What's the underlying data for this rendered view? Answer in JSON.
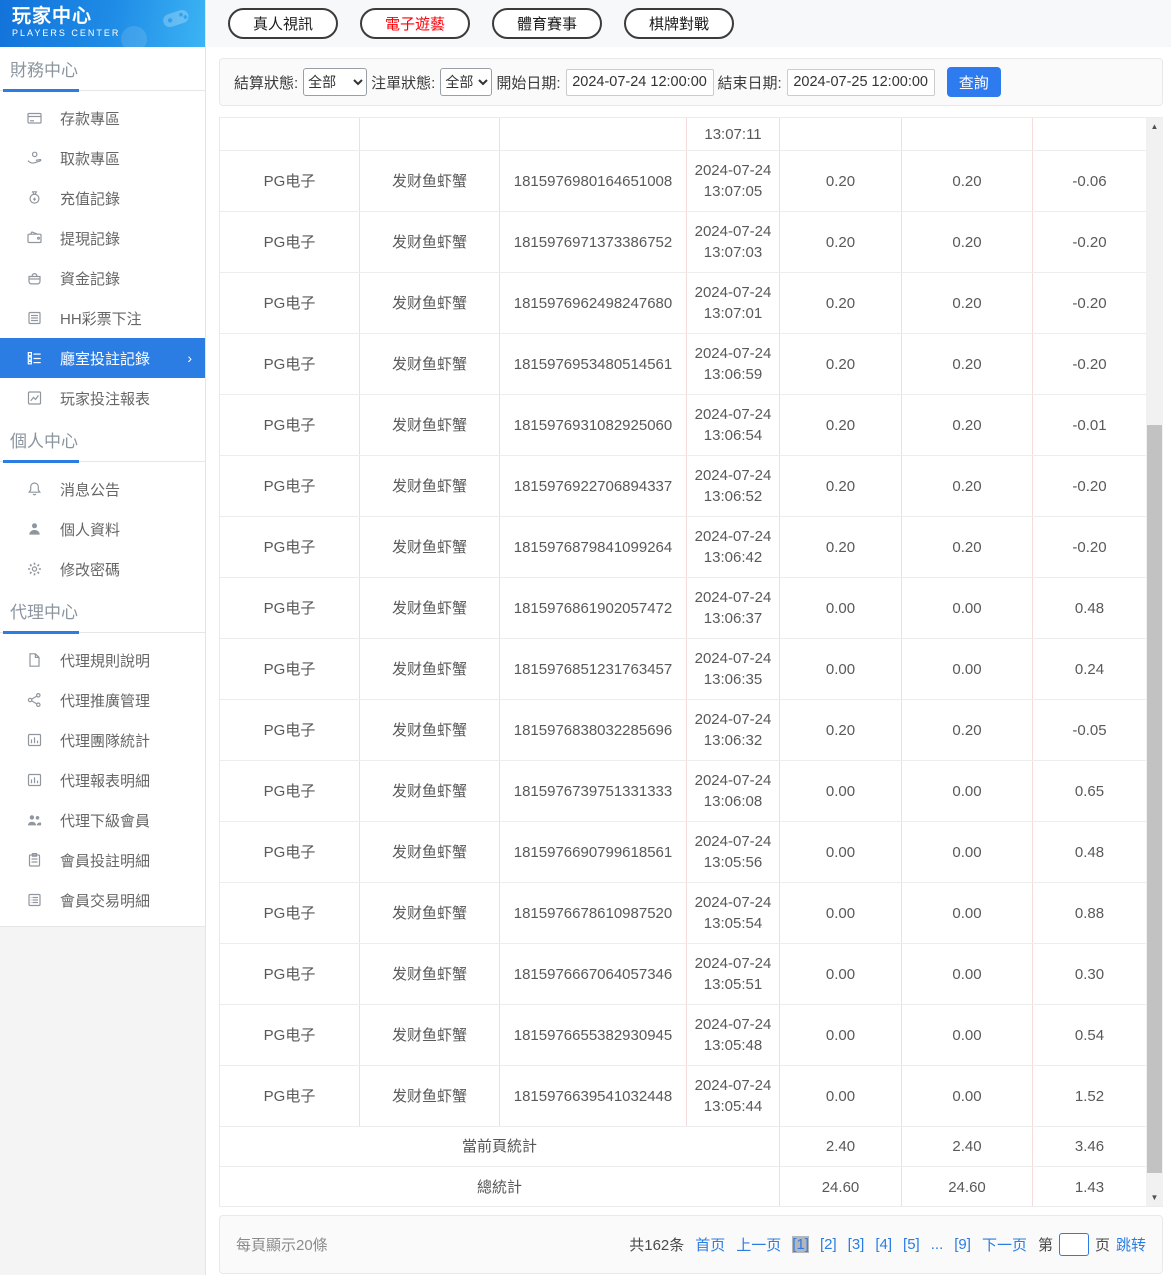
{
  "sidebar": {
    "title": "玩家中心",
    "subtitle": "PLAYERS CENTER",
    "sections": [
      {
        "header": "財務中心",
        "items": [
          {
            "id": "deposit-zone",
            "label": "存款專區",
            "icon": "card",
            "active": false
          },
          {
            "id": "withdraw-zone",
            "label": "取款專區",
            "icon": "hand",
            "active": false
          },
          {
            "id": "recharge-records",
            "label": "充值記錄",
            "icon": "moneybag",
            "active": false
          },
          {
            "id": "withdrawal-records",
            "label": "提現記錄",
            "icon": "wallet",
            "active": false
          },
          {
            "id": "funds-records",
            "label": "資金記錄",
            "icon": "purse",
            "active": false
          },
          {
            "id": "hh-lottery-bets",
            "label": "HH彩票下注",
            "icon": "doc",
            "active": false
          },
          {
            "id": "hall-bet-records",
            "label": "廳室投註記錄",
            "icon": "list",
            "active": true
          },
          {
            "id": "player-bet-report",
            "label": "玩家投注報表",
            "icon": "chart",
            "active": false
          }
        ]
      },
      {
        "header": "個人中心",
        "items": [
          {
            "id": "announcements",
            "label": "消息公告",
            "icon": "bell",
            "active": false
          },
          {
            "id": "profile",
            "label": "個人資料",
            "icon": "person",
            "active": false
          },
          {
            "id": "change-password",
            "label": "修改密碼",
            "icon": "gear",
            "active": false
          }
        ]
      },
      {
        "header": "代理中心",
        "items": [
          {
            "id": "agent-rules",
            "label": "代理規則說明",
            "icon": "file",
            "active": false
          },
          {
            "id": "agent-promotion",
            "label": "代理推廣管理",
            "icon": "share",
            "active": false
          },
          {
            "id": "agent-team-stats",
            "label": "代理團隊統計",
            "icon": "stats",
            "active": false
          },
          {
            "id": "agent-report-detail",
            "label": "代理報表明細",
            "icon": "stats",
            "active": false
          },
          {
            "id": "agent-sub-members",
            "label": "代理下級會員",
            "icon": "people",
            "active": false
          },
          {
            "id": "member-bet-detail",
            "label": "會員投註明細",
            "icon": "clipboard",
            "active": false
          },
          {
            "id": "member-trade-detail",
            "label": "會員交易明細",
            "icon": "listdoc",
            "active": false
          }
        ]
      }
    ]
  },
  "tabs": [
    {
      "id": "live-video",
      "label": "真人視訊",
      "active": false
    },
    {
      "id": "e-games",
      "label": "電子遊藝",
      "active": true
    },
    {
      "id": "sports",
      "label": "體育賽事",
      "active": false
    },
    {
      "id": "board-games",
      "label": "棋牌對戰",
      "active": false
    }
  ],
  "filters": {
    "settle_label": "結算狀態:",
    "settle_value": "全部",
    "order_label": "注單狀態:",
    "order_value": "全部",
    "start_label": "開始日期:",
    "start_value": "2024-07-24 12:00:00",
    "end_label": "結束日期:",
    "end_value": "2024-07-25 12:00:00",
    "search_label": "查詢"
  },
  "table": {
    "partial_row_time": "13:07:11",
    "rows": [
      {
        "platform": "PG电子",
        "game": "发财鱼虾蟹",
        "bet_id": "1815976980164651008",
        "date": "2024-07-24",
        "time": "13:07:05",
        "bet": "0.20",
        "valid": "0.20",
        "profit": "-0.06"
      },
      {
        "platform": "PG电子",
        "game": "发财鱼虾蟹",
        "bet_id": "1815976971373386752",
        "date": "2024-07-24",
        "time": "13:07:03",
        "bet": "0.20",
        "valid": "0.20",
        "profit": "-0.20"
      },
      {
        "platform": "PG电子",
        "game": "发财鱼虾蟹",
        "bet_id": "1815976962498247680",
        "date": "2024-07-24",
        "time": "13:07:01",
        "bet": "0.20",
        "valid": "0.20",
        "profit": "-0.20"
      },
      {
        "platform": "PG电子",
        "game": "发财鱼虾蟹",
        "bet_id": "1815976953480514561",
        "date": "2024-07-24",
        "time": "13:06:59",
        "bet": "0.20",
        "valid": "0.20",
        "profit": "-0.20"
      },
      {
        "platform": "PG电子",
        "game": "发财鱼虾蟹",
        "bet_id": "1815976931082925060",
        "date": "2024-07-24",
        "time": "13:06:54",
        "bet": "0.20",
        "valid": "0.20",
        "profit": "-0.01"
      },
      {
        "platform": "PG电子",
        "game": "发财鱼虾蟹",
        "bet_id": "1815976922706894337",
        "date": "2024-07-24",
        "time": "13:06:52",
        "bet": "0.20",
        "valid": "0.20",
        "profit": "-0.20"
      },
      {
        "platform": "PG电子",
        "game": "发财鱼虾蟹",
        "bet_id": "1815976879841099264",
        "date": "2024-07-24",
        "time": "13:06:42",
        "bet": "0.20",
        "valid": "0.20",
        "profit": "-0.20"
      },
      {
        "platform": "PG电子",
        "game": "发财鱼虾蟹",
        "bet_id": "1815976861902057472",
        "date": "2024-07-24",
        "time": "13:06:37",
        "bet": "0.00",
        "valid": "0.00",
        "profit": "0.48"
      },
      {
        "platform": "PG电子",
        "game": "发财鱼虾蟹",
        "bet_id": "1815976851231763457",
        "date": "2024-07-24",
        "time": "13:06:35",
        "bet": "0.00",
        "valid": "0.00",
        "profit": "0.24"
      },
      {
        "platform": "PG电子",
        "game": "发财鱼虾蟹",
        "bet_id": "1815976838032285696",
        "date": "2024-07-24",
        "time": "13:06:32",
        "bet": "0.20",
        "valid": "0.20",
        "profit": "-0.05"
      },
      {
        "platform": "PG电子",
        "game": "发财鱼虾蟹",
        "bet_id": "1815976739751331333",
        "date": "2024-07-24",
        "time": "13:06:08",
        "bet": "0.00",
        "valid": "0.00",
        "profit": "0.65"
      },
      {
        "platform": "PG电子",
        "game": "发财鱼虾蟹",
        "bet_id": "1815976690799618561",
        "date": "2024-07-24",
        "time": "13:05:56",
        "bet": "0.00",
        "valid": "0.00",
        "profit": "0.48"
      },
      {
        "platform": "PG电子",
        "game": "发财鱼虾蟹",
        "bet_id": "1815976678610987520",
        "date": "2024-07-24",
        "time": "13:05:54",
        "bet": "0.00",
        "valid": "0.00",
        "profit": "0.88"
      },
      {
        "platform": "PG电子",
        "game": "发财鱼虾蟹",
        "bet_id": "1815976667064057346",
        "date": "2024-07-24",
        "time": "13:05:51",
        "bet": "0.00",
        "valid": "0.00",
        "profit": "0.30"
      },
      {
        "platform": "PG电子",
        "game": "发财鱼虾蟹",
        "bet_id": "1815976655382930945",
        "date": "2024-07-24",
        "time": "13:05:48",
        "bet": "0.00",
        "valid": "0.00",
        "profit": "0.54"
      },
      {
        "platform": "PG电子",
        "game": "发财鱼虾蟹",
        "bet_id": "1815976639541032448",
        "date": "2024-07-24",
        "time": "13:05:44",
        "bet": "0.00",
        "valid": "0.00",
        "profit": "1.52"
      }
    ],
    "summaries": [
      {
        "label": "當前頁統計",
        "bet": "2.40",
        "valid": "2.40",
        "profit": "3.46"
      },
      {
        "label": "總統計",
        "bet": "24.60",
        "valid": "24.60",
        "profit": "1.43"
      }
    ]
  },
  "pagination": {
    "page_size_text": "每頁顯示20條",
    "total_text": "共162条",
    "first_label": "首页",
    "prev_label": "上一页",
    "pages": [
      {
        "label": "[1]",
        "current": true
      },
      {
        "label": "[2]",
        "current": false
      },
      {
        "label": "[3]",
        "current": false
      },
      {
        "label": "[4]",
        "current": false
      },
      {
        "label": "[5]",
        "current": false
      },
      {
        "label": "...",
        "current": false
      },
      {
        "label": "[9]",
        "current": false
      }
    ],
    "next_label": "下一页",
    "jump_prefix": "第",
    "jump_value": "",
    "jump_suffix": "页",
    "jump_label": "跳转"
  },
  "colors": {
    "accent_blue": "#2b7de3",
    "active_tab_red": "#fb0007",
    "table_vertical_border": "#f5dbdb",
    "table_horizontal_border": "#ededee",
    "current_page_bg": "#b4b6bd",
    "scrollbar_thumb": "#c2c2c2"
  }
}
